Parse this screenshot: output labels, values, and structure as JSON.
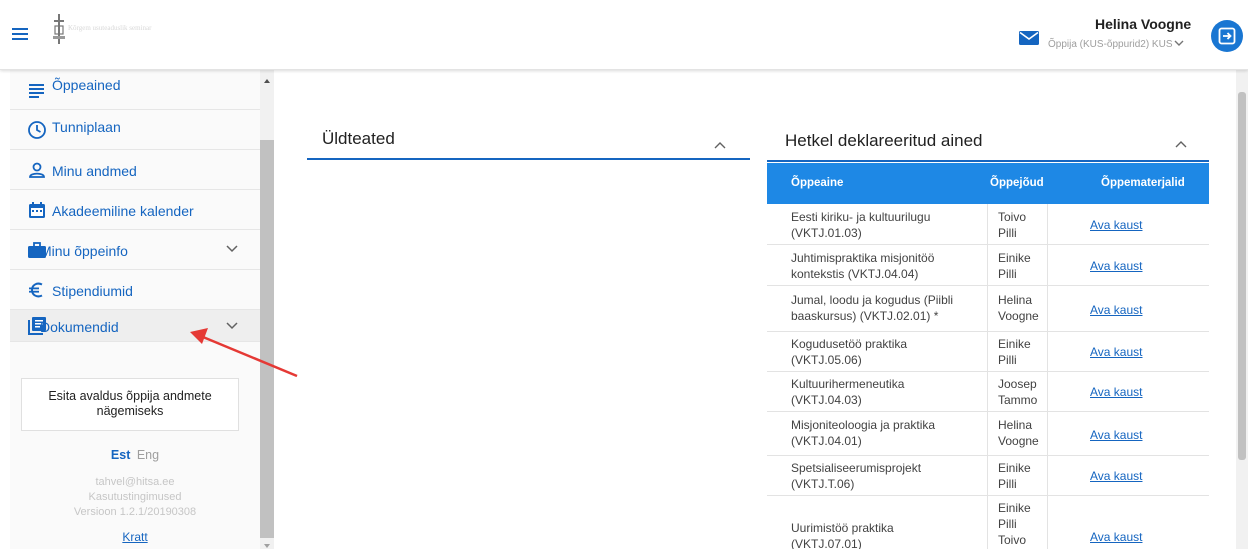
{
  "header": {
    "logo_text": "Kõrgem usuteaduslik seminar",
    "user_name": "Helina Voogne",
    "user_role": "Õppija (KUS-õppurid2) KUS"
  },
  "sidebar": {
    "items": [
      {
        "label": "Õppeained",
        "icon": "list-icon"
      },
      {
        "label": "Tunniplaan",
        "icon": "clock-icon"
      },
      {
        "label": "Minu andmed",
        "icon": "person-icon"
      },
      {
        "label": "Akadeemiline kalender",
        "icon": "calendar-icon"
      },
      {
        "label": "Minu õppeinfo",
        "icon": "briefcase-icon"
      },
      {
        "label": "Stipendiumid",
        "icon": "euro-icon"
      },
      {
        "label": "Dokumendid",
        "icon": "library-books-icon"
      }
    ],
    "apply_button": "Esita avaldus õppija andmete nägemiseks",
    "lang_est": "Est",
    "lang_eng": "Eng",
    "email": "tahvel@hitsa.ee",
    "terms": "Kasutustingimused",
    "version": "Versioon 1.2.1/20190308",
    "kratt": "Kratt"
  },
  "general": {
    "title": "Üldteated"
  },
  "declared": {
    "title": "Hetkel deklareeritud ained",
    "columns": [
      "Õppeaine",
      "Õppejõud",
      "Õppematerjalid"
    ],
    "link_label": "Ava kaust",
    "rows": [
      {
        "subject": "Eesti kiriku- ja kultuurilugu (VKTJ.01.03)",
        "teacher": "Toivo Pilli"
      },
      {
        "subject": "Juhtimispraktika misjonitöö kontekstis (VKTJ.04.04)",
        "teacher": "Einike Pilli"
      },
      {
        "subject": "Jumal, loodu ja kogudus (Piibli baaskursus) (VKTJ.02.01) *",
        "teacher": "Helina Voogne"
      },
      {
        "subject": "Kogudusetöö praktika (VKTJ.05.06)",
        "teacher": "Einike Pilli"
      },
      {
        "subject": "Kultuurihermeneutika (VKTJ.04.03)",
        "teacher": "Joosep Tammo"
      },
      {
        "subject": "Misjoniteoloogia ja praktika (VKTJ.04.01)",
        "teacher": "Helina Voogne"
      },
      {
        "subject": "Spetsialiseerumisprojekt (VKTJ.T.06)",
        "teacher": "Einike Pilli"
      },
      {
        "subject": "Uurimistöö praktika (VKTJ.07.01)",
        "teacher": "Einike Pilli Toivo"
      }
    ]
  },
  "colors": {
    "primary": "#1565c0",
    "table_header": "#1e88e5",
    "annotation": "#e53935"
  }
}
